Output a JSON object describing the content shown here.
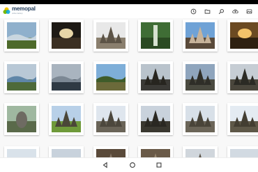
{
  "app": {
    "logo_name": "memopal",
    "logo_tag": "online backup",
    "brand_color": "#2e5f8a",
    "logo_colors": [
      "#f5c400",
      "#7ab800",
      "#00a3d9"
    ]
  },
  "toolbar": {
    "actions": [
      {
        "name": "history-icon",
        "label": "history"
      },
      {
        "name": "folder-icon",
        "label": "folders"
      },
      {
        "name": "search-icon",
        "label": "search"
      },
      {
        "name": "cloud-upload-icon",
        "label": "upload"
      },
      {
        "name": "gallery-icon",
        "label": "gallery"
      }
    ]
  },
  "photos": [
    {
      "subject": "coastal cliffs landscape",
      "sky": "#8fb0cc",
      "ground": "#4d6a2a",
      "accent": "#c9d6df"
    },
    {
      "subject": "dark cave interior",
      "sky": "#1e1a15",
      "ground": "#3b2f22",
      "accent": "#e8d6a8"
    },
    {
      "subject": "stone temple facade",
      "sky": "#e8e8e8",
      "ground": "#8a7f6e",
      "accent": "#5c5346"
    },
    {
      "subject": "forest waterfall",
      "sky": "#3f6d35",
      "ground": "#2a4a22",
      "accent": "#d6e2d0"
    },
    {
      "subject": "temple gate under blue sky",
      "sky": "#6fa2d6",
      "ground": "#5a4a3a",
      "accent": "#c7b39a"
    },
    {
      "subject": "dome ceiling with light",
      "sky": "#6b4a22",
      "ground": "#2e2010",
      "accent": "#f2c26a"
    },
    {
      "subject": "green coastline",
      "sky": "#b8c8d6",
      "ground": "#4e6a3a",
      "accent": "#5f86a8"
    },
    {
      "subject": "calm sea at dusk",
      "sky": "#a9b4bf",
      "ground": "#2f3a44",
      "accent": "#7c8894"
    },
    {
      "subject": "sea cliff with vegetation",
      "sky": "#7eaed8",
      "ground": "#6b6a3a",
      "accent": "#3f5c2a"
    },
    {
      "subject": "temple silhouettes",
      "sky": "#b9c3cc",
      "ground": "#3b3a36",
      "accent": "#27251f"
    },
    {
      "subject": "temple complex under cloudy sky",
      "sky": "#8fa5bd",
      "ground": "#4a4a40",
      "accent": "#2f2e28"
    },
    {
      "subject": "temple spires",
      "sky": "#c6cdd4",
      "ground": "#4a463c",
      "accent": "#2b2a24"
    },
    {
      "subject": "stone statue in garden",
      "sky": "#9fb8a0",
      "ground": "#5a6a4a",
      "accent": "#6e6b62"
    },
    {
      "subject": "temples on green lawn",
      "sky": "#b8d0e8",
      "ground": "#6f9a3a",
      "accent": "#4a4638"
    },
    {
      "subject": "temple towers",
      "sky": "#dfe6ee",
      "ground": "#6a6458",
      "accent": "#4c473d"
    },
    {
      "subject": "ornate temple pillars",
      "sky": "#c9d2dc",
      "ground": "#3a3830",
      "accent": "#2a2822"
    },
    {
      "subject": "single temple spire",
      "sky": "#d8e0e8",
      "ground": "#6b6558",
      "accent": "#494439"
    },
    {
      "subject": "tall temple against sky",
      "sky": "#e4ebf2",
      "ground": "#5e5848",
      "accent": "#433e32"
    },
    {
      "subject": "partially visible landscape",
      "sky": "#d9e2ea",
      "ground": "#8a9aa8",
      "accent": "#c0c8d0"
    },
    {
      "subject": "partially visible landscape",
      "sky": "#c8d2dc",
      "ground": "#7c8a98",
      "accent": "#b0bac4"
    },
    {
      "subject": "partially visible temple",
      "sky": "#5a4a3a",
      "ground": "#3a3028",
      "accent": "#8a7a6a"
    },
    {
      "subject": "partially visible temple",
      "sky": "#6a5a48",
      "ground": "#3f352a",
      "accent": "#9a8a72"
    },
    {
      "subject": "partially visible temple",
      "sky": "#d0d6dc",
      "ground": "#7a7468",
      "accent": "#5a5448"
    },
    {
      "subject": "partially visible landscape",
      "sky": "#d2dae2",
      "ground": "#9aa4ae",
      "accent": "#bcc4cc"
    }
  ],
  "navigation": [
    {
      "name": "back-icon"
    },
    {
      "name": "home-icon"
    },
    {
      "name": "recents-icon"
    }
  ]
}
